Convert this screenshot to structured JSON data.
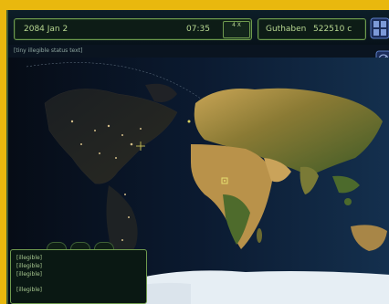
{
  "topbar": {
    "date": "2084 Jan 2",
    "time": "07:35",
    "speed_label": "4 X",
    "funds_label": "Guthaben",
    "funds_value": "522510 c"
  },
  "icons": {
    "geoscape_button": "grid-icon",
    "side_button": "radar-icon"
  },
  "status_line": "[tiny illegible status text]",
  "messages": {
    "line1": "[illegible]",
    "line2": "[illegible]",
    "line3": "[illegible]",
    "line4": "[illegible]"
  },
  "colors": {
    "frame_yellow": "#e9b80e",
    "panel_green": "#6f9a4e",
    "panel_text": "#b8d891"
  }
}
